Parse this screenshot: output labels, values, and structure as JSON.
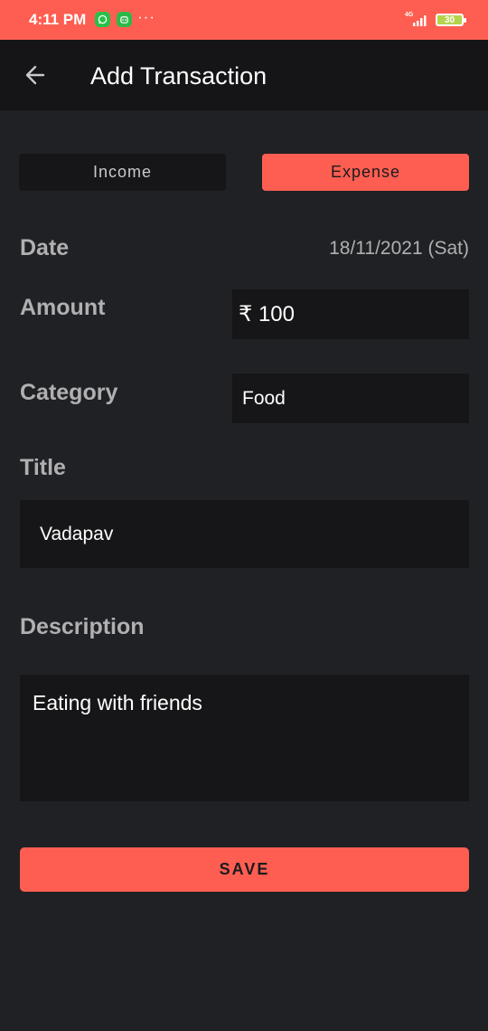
{
  "status_bar": {
    "time": "4:11 PM",
    "more_indicator": "···",
    "network": "4G",
    "battery": "30"
  },
  "app_bar": {
    "title": "Add Transaction",
    "back_icon": "arrow-left-icon"
  },
  "type_toggle": {
    "income_label": "Income",
    "expense_label": "Expense",
    "selected": "Expense"
  },
  "form": {
    "date_label": "Date",
    "date_value": "18/11/2021 (Sat)",
    "amount_label": "Amount",
    "amount_value": "₹ 100",
    "category_label": "Category",
    "category_value": "Food",
    "title_label": "Title",
    "title_value": "Vadapav",
    "description_label": "Description",
    "description_value": "Eating with friends"
  },
  "actions": {
    "save_label": "SAVE"
  },
  "colors": {
    "accent": "#fe5e51",
    "background": "#202124",
    "field_background": "#161618",
    "label_text": "#b0b0b2"
  }
}
